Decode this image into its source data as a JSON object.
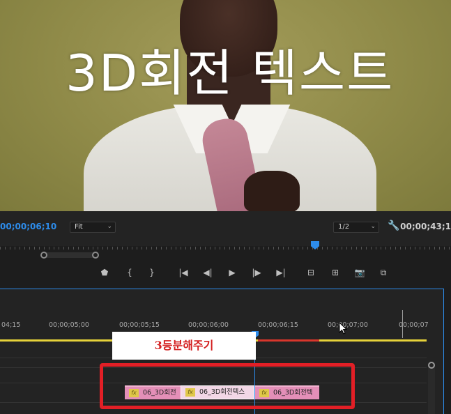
{
  "program_monitor": {
    "overlay_title": "3D회전 텍스트",
    "current_timecode": "00;00;06;10",
    "zoom_value": "Fit",
    "resolution_value": "1/2",
    "duration_timecode": "00;00;43;1"
  },
  "transport": {
    "buttons": [
      {
        "name": "add-marker-button",
        "icon": "marker-icon",
        "glyph": "⬟"
      },
      {
        "name": "mark-in-button",
        "icon": "mark-in-icon",
        "glyph": "{"
      },
      {
        "name": "mark-out-button",
        "icon": "mark-out-icon",
        "glyph": "}"
      },
      {
        "name": "go-to-in-button",
        "icon": "go-to-in-icon",
        "glyph": "|◀"
      },
      {
        "name": "step-back-button",
        "icon": "step-back-icon",
        "glyph": "◀|"
      },
      {
        "name": "play-button",
        "icon": "play-icon",
        "glyph": "▶"
      },
      {
        "name": "step-forward-button",
        "icon": "step-forward-icon",
        "glyph": "|▶"
      },
      {
        "name": "go-to-out-button",
        "icon": "go-to-out-icon",
        "glyph": "▶|"
      },
      {
        "name": "lift-button",
        "icon": "lift-icon",
        "glyph": "⊟"
      },
      {
        "name": "extract-button",
        "icon": "extract-icon",
        "glyph": "⊞"
      },
      {
        "name": "export-frame-button",
        "icon": "camera-icon",
        "glyph": "📷"
      },
      {
        "name": "comparison-view-button",
        "icon": "comparison-view-icon",
        "glyph": "⧉"
      }
    ]
  },
  "timeline": {
    "ruler_labels": [
      "04;15",
      "00;00;05;00",
      "00;00;05;15",
      "00;00;06;00",
      "00;00;06;15",
      "00;00;07;00",
      "00;00;07"
    ],
    "clips": [
      {
        "label": "06_3D회전",
        "fx": "fx"
      },
      {
        "label": "06_3D회전텍스",
        "fx": "fx"
      },
      {
        "label": "06_3D회전텍",
        "fx": "fx"
      }
    ]
  },
  "annotation": {
    "callout_text": "3등분해주기",
    "accent_color": "#e21f26"
  }
}
